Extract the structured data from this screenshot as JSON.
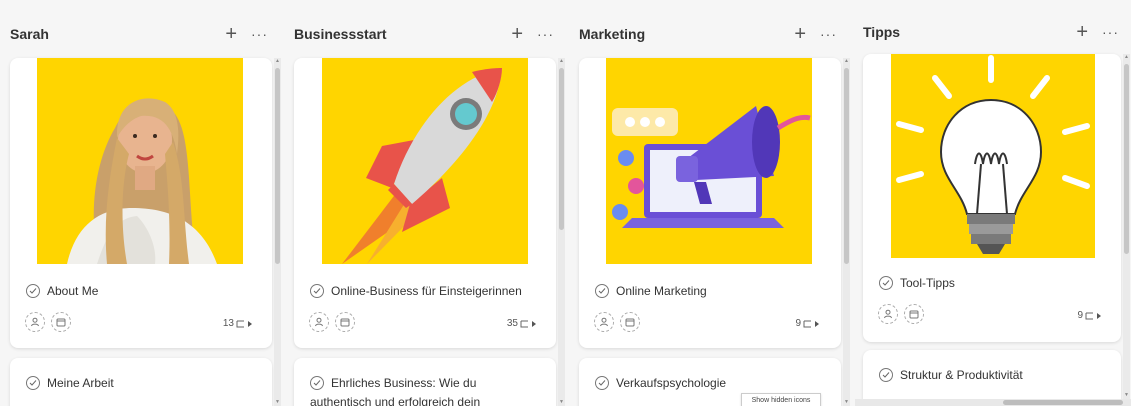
{
  "columns": [
    {
      "title": "Sarah",
      "add_label": "+",
      "more_label": "···",
      "cards": [
        {
          "title": "About Me",
          "count": "13",
          "image": "portrait-photo"
        },
        {
          "title": "Meine Arbeit"
        }
      ]
    },
    {
      "title": "Businessstart",
      "add_label": "+",
      "more_label": "···",
      "cards": [
        {
          "title": "Online-Business für Einsteigerinnen",
          "count": "35",
          "image": "rocket-illustration"
        },
        {
          "title": "Ehrliches Business: Wie du",
          "title_line2": "authentisch und erfolgreich dein"
        }
      ]
    },
    {
      "title": "Marketing",
      "add_label": "+",
      "more_label": "···",
      "cards": [
        {
          "title": "Online Marketing",
          "count": "9",
          "image": "megaphone-illustration"
        },
        {
          "title": "Verkaufspsychologie"
        }
      ]
    },
    {
      "title": "Tipps",
      "add_label": "+",
      "more_label": "···",
      "cards": [
        {
          "title": "Tool-Tipps",
          "count": "9",
          "image": "lightbulb-illustration"
        },
        {
          "title": "Struktur & Produktivität"
        }
      ]
    }
  ],
  "tooltip": "Show hidden icons",
  "colors": {
    "card_image_bg": "#ffd500",
    "accent_purple": "#6a4fd6",
    "rocket_red": "#e8534a"
  },
  "icons": [
    "plus-icon",
    "more-icon",
    "check-circle-icon",
    "person-icon",
    "calendar-icon",
    "subtask-icon"
  ]
}
